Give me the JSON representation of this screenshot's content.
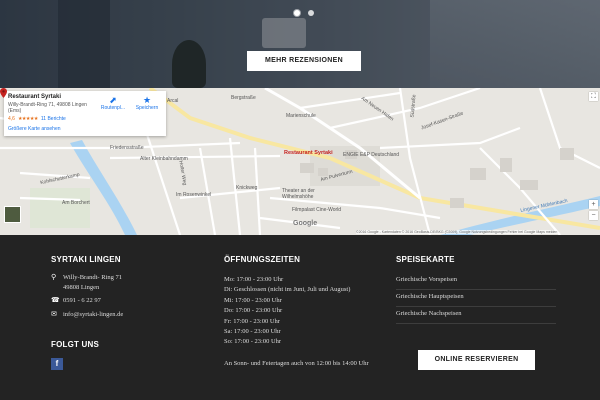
{
  "hero": {
    "reviews_button": "MEHR REZENSIONEN"
  },
  "map": {
    "card": {
      "name": "Restaurant Syrtaki",
      "address": "Willy-Brandt-Ring 71, 49808 Lingen (Ems)",
      "rating": "4,6",
      "stars": "★★★★★",
      "reviews": "11 Berichte",
      "bigger_map": "Größere Karte ansehen",
      "route_label": "Routenpl...",
      "save_label": "Speichern"
    },
    "pin_label": "Restaurant Syrtaki",
    "streets": [
      "Bergstraße",
      "Marienschule",
      "Am Neuen Hafen",
      "Josef-Kasen-Straße",
      "Friedensstraße",
      "Alter Kleinbahndamm",
      "Kohlschutterkamp",
      "Am Borchert",
      "Holter Weg",
      "Im Rosenwinkel",
      "Knickweg",
      "Theater an der Wilhelmshöhe",
      "Filmpalast Cine-World",
      "ENGIE E&P Deutschland",
      "Am Pulverturm",
      "Lingener Mühlenbach",
      "Arcal",
      "Südstraße"
    ],
    "google": "Google",
    "attribution": "©2016 Google - Kartendaten © 2016 GeoBasis-DE/BKG (©2009), Google   Nutzungsbedingungen   Fehler bei Google Maps melden",
    "zoom_in": "+",
    "zoom_out": "−"
  },
  "footer": {
    "contact": {
      "title": "SYRTAKI LINGEN",
      "address_line1": "Willy-Brandt- Ring 71",
      "address_line2": "49808 Lingen",
      "phone": "0591 - 6 22 97",
      "email": "info@syrtaki-lingen.de"
    },
    "follow": {
      "title": "FOLGT UNS",
      "facebook": "f"
    },
    "hours": {
      "title": "ÖFFNUNGSZEITEN",
      "lines": [
        "Mo: 17:00 - 23:00 Uhr",
        "Di: Geschlossen (nicht im Juni, Juli und August)",
        "Mi: 17:00 - 23:00 Uhr",
        "Do: 17:00 - 23:00 Uhr",
        "Fr: 17:00 - 23:00 Uhr",
        "Sa: 17:00 - 23:00 Uhr",
        "So: 17:00 - 23:00 Uhr"
      ],
      "note": "An Sonn- und Feiertagen auch von 12:00 bis 14:00 Uhr"
    },
    "menu": {
      "title": "SPEISEKARTE",
      "items": [
        "Griechische Vorspeisen",
        "Griechische Hauptspeisen",
        "Griechische Nachspeisen"
      ],
      "reserve_button": "ONLINE RESERVIEREN"
    }
  },
  "colors": {
    "footer_bg": "#232323",
    "map_bg": "#e8e6e1",
    "river": "#aad3f2",
    "pin": "#c5221f",
    "link": "#1a73e8",
    "facebook": "#3b5998"
  }
}
